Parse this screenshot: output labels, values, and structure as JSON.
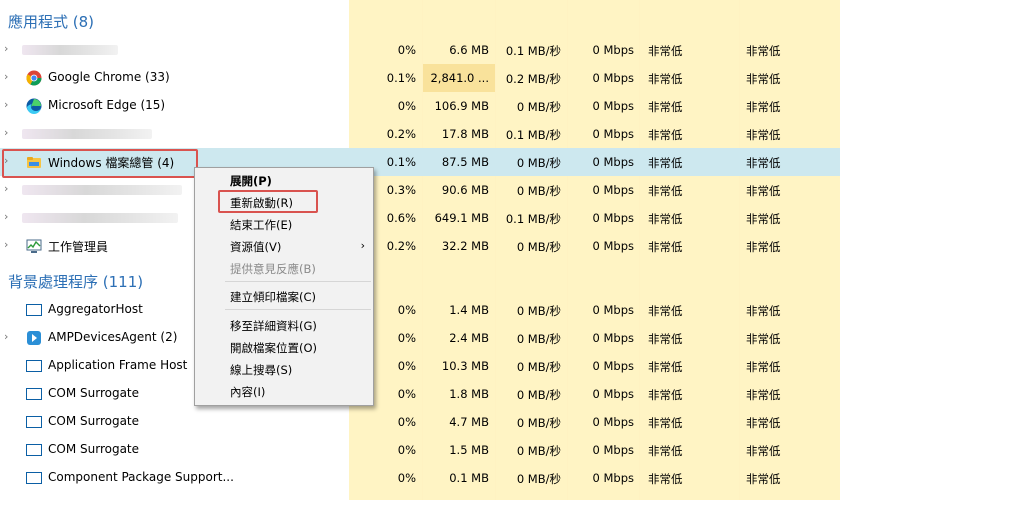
{
  "colors": {
    "accent": "#2c6fb5",
    "highlight_cell": "#f9e29b",
    "cell": "#fff4c4",
    "selected_row": "#cde8ef",
    "red_box": "#d9534f"
  },
  "sections": {
    "apps": "應用程式 (8)",
    "background": "背景處理程序 (111)"
  },
  "rows": [
    {
      "name": "",
      "cpu": "0%",
      "mem": "6.6 MB",
      "disk": "0.1 MB/秒",
      "net": "0 Mbps",
      "power": "非常低",
      "power_trend": "非常低"
    },
    {
      "name": "Google Chrome (33)",
      "icon": "chrome-icon",
      "cpu": "0.1%",
      "mem": "2,841.0 ...",
      "disk": "0.2 MB/秒",
      "net": "0 Mbps",
      "power": "非常低",
      "power_trend": "非常低"
    },
    {
      "name": "Microsoft Edge (15)",
      "icon": "edge-icon",
      "cpu": "0%",
      "mem": "106.9 MB",
      "disk": "0 MB/秒",
      "net": "0 Mbps",
      "power": "非常低",
      "power_trend": "非常低"
    },
    {
      "name": "",
      "cpu": "0.2%",
      "mem": "17.8 MB",
      "disk": "0.1 MB/秒",
      "net": "0 Mbps",
      "power": "非常低",
      "power_trend": "非常低"
    },
    {
      "name": "Windows 檔案總管 (4)",
      "icon": "folder-icon",
      "cpu": "0.1%",
      "mem": "87.5 MB",
      "disk": "0 MB/秒",
      "net": "0 Mbps",
      "power": "非常低",
      "power_trend": "非常低"
    },
    {
      "name": "",
      "cpu": "0.3%",
      "mem": "90.6 MB",
      "disk": "0 MB/秒",
      "net": "0 Mbps",
      "power": "非常低",
      "power_trend": "非常低"
    },
    {
      "name": "",
      "cpu": "0.6%",
      "mem": "649.1 MB",
      "disk": "0.1 MB/秒",
      "net": "0 Mbps",
      "power": "非常低",
      "power_trend": "非常低"
    },
    {
      "name": "工作管理員",
      "icon": "task-manager-icon",
      "cpu": "0.2%",
      "mem": "32.2 MB",
      "disk": "0 MB/秒",
      "net": "0 Mbps",
      "power": "非常低",
      "power_trend": "非常低"
    }
  ],
  "bg_rows": [
    {
      "name": "AggregatorHost",
      "cpu": "0%",
      "mem": "1.4 MB",
      "disk": "0 MB/秒",
      "net": "0 Mbps",
      "power": "非常低",
      "power_trend": "非常低"
    },
    {
      "name": "AMPDevicesAgent (2)",
      "cpu": "0%",
      "mem": "2.4 MB",
      "disk": "0 MB/秒",
      "net": "0 Mbps",
      "power": "非常低",
      "power_trend": "非常低"
    },
    {
      "name": "Application Frame Host",
      "cpu": "0%",
      "mem": "10.3 MB",
      "disk": "0 MB/秒",
      "net": "0 Mbps",
      "power": "非常低",
      "power_trend": "非常低"
    },
    {
      "name": "COM Surrogate",
      "cpu": "0%",
      "mem": "1.8 MB",
      "disk": "0 MB/秒",
      "net": "0 Mbps",
      "power": "非常低",
      "power_trend": "非常低"
    },
    {
      "name": "COM Surrogate",
      "cpu": "0%",
      "mem": "4.7 MB",
      "disk": "0 MB/秒",
      "net": "0 Mbps",
      "power": "非常低",
      "power_trend": "非常低"
    },
    {
      "name": "COM Surrogate",
      "cpu": "0%",
      "mem": "1.5 MB",
      "disk": "0 MB/秒",
      "net": "0 Mbps",
      "power": "非常低",
      "power_trend": "非常低"
    },
    {
      "name": "Component Package Support...",
      "cpu": "0%",
      "mem": "0.1 MB",
      "disk": "0 MB/秒",
      "net": "0 Mbps",
      "power": "非常低",
      "power_trend": "非常低"
    }
  ],
  "context_menu": {
    "expand": "展開(P)",
    "restart": "重新啟動(R)",
    "end_task": "結束工作(E)",
    "resource_values": "資源值(V)",
    "feedback": "提供意見反應(B)",
    "create_dump": "建立傾印檔案(C)",
    "go_to_details": "移至詳細資料(G)",
    "open_location": "開啟檔案位置(O)",
    "search_online": "線上搜尋(S)",
    "properties": "內容(I)"
  }
}
